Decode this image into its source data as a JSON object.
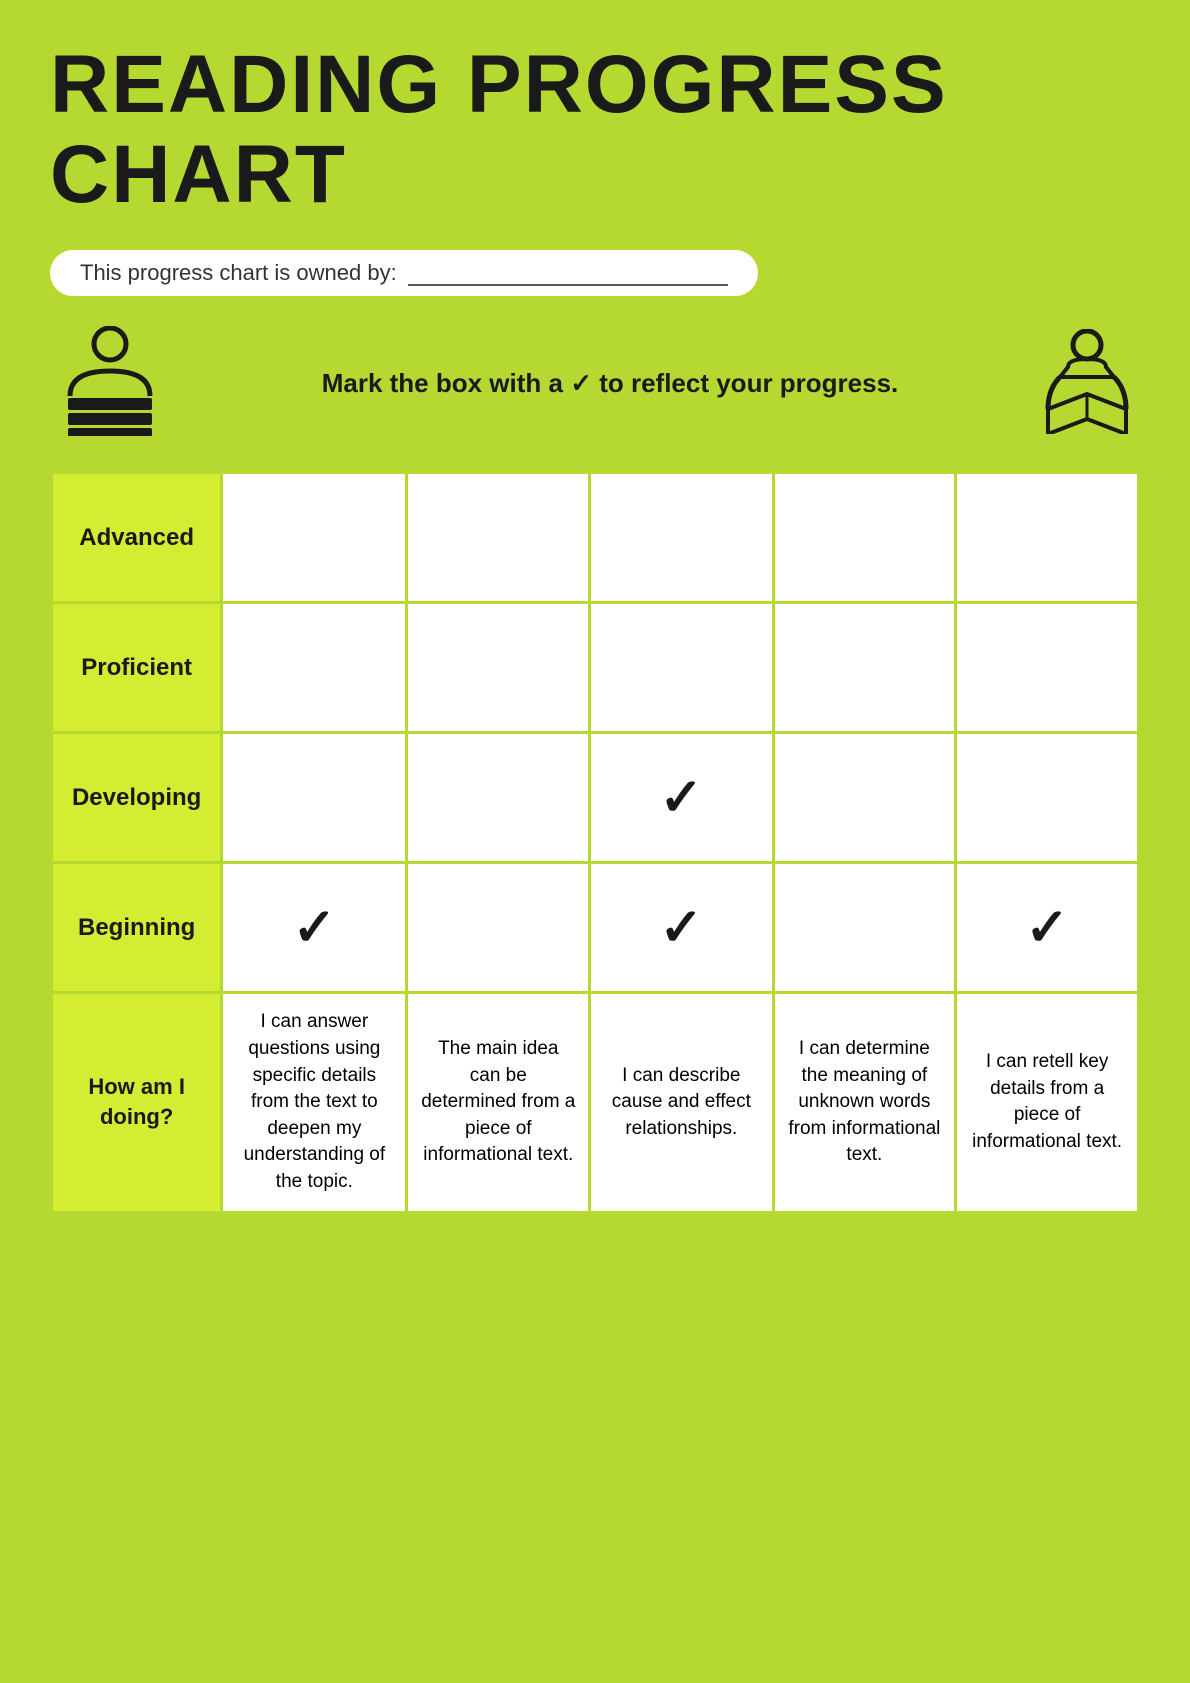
{
  "page": {
    "title": "READING PROGRESS CHART",
    "owner_label": "This progress chart is owned by:",
    "instruction": "Mark the box with a ✓ to reflect your progress.",
    "rows": [
      {
        "label": "Advanced",
        "cells": [
          false,
          false,
          false,
          false,
          false
        ]
      },
      {
        "label": "Proficient",
        "cells": [
          false,
          false,
          false,
          false,
          false
        ]
      },
      {
        "label": "Developing",
        "cells": [
          false,
          false,
          true,
          false,
          false
        ]
      },
      {
        "label": "Beginning",
        "cells": [
          true,
          false,
          true,
          false,
          true
        ]
      }
    ],
    "descriptions": [
      "I can answer questions using specific details from the text to deepen my understanding of the topic.",
      "The main idea can be determined from a piece of informational text.",
      "I can describe cause and effect relationships.",
      "I can determine the meaning of unknown words from informational text.",
      "I can retell key details from a piece of informational text."
    ],
    "how_label": "How am I doing?"
  }
}
